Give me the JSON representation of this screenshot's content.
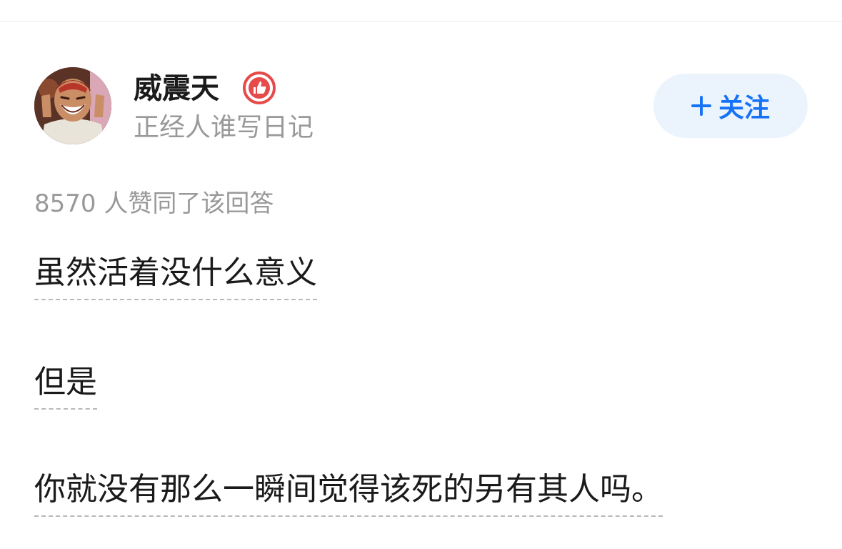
{
  "author": {
    "name": "威震天",
    "headline": "正经人谁写日记",
    "avatar_icon": "avatar-laughing-man",
    "badge_icon": "thumbs-up-badge-icon",
    "badge_color": "#e64a4a"
  },
  "follow_button": {
    "label": "关注",
    "icon": "plus-icon",
    "accent": "#1772f6",
    "background": "#ebf4fd"
  },
  "answer": {
    "vote_text": "8570 人赞同了该回答",
    "paragraphs": [
      "虽然活着没什么意义",
      "但是",
      "你就没有那么一瞬间觉得该死的另有其人吗。"
    ]
  }
}
